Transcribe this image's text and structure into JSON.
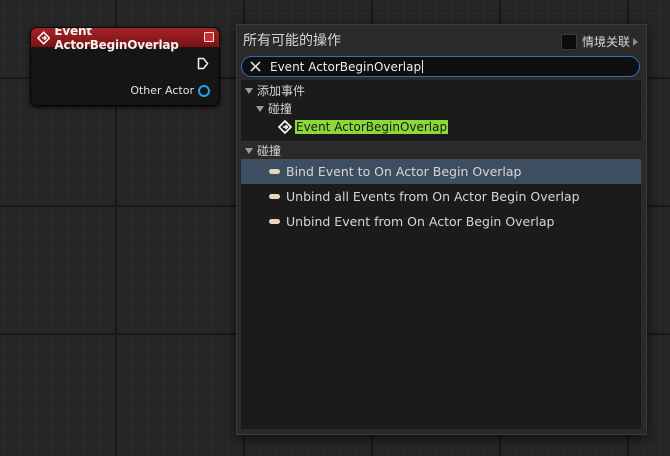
{
  "node": {
    "title": "Event ActorBeginOverlap",
    "pin_label": "Other Actor",
    "header_color": "#a52326",
    "pin_color": "#22a4e6",
    "header_icon": "event-diamond-icon"
  },
  "menu": {
    "title": "所有可能的操作",
    "context_label": "情境关联",
    "search_value": "Event ActorBeginOverlap",
    "tree": [
      {
        "label": "添加事件",
        "type": "category",
        "level": 0
      },
      {
        "label": "碰撞",
        "type": "category",
        "level": 1
      },
      {
        "label": "Event ActorBeginOverlap",
        "type": "event",
        "level": 2,
        "matched": true
      },
      {
        "label": "碰撞",
        "type": "category",
        "level": 0
      }
    ],
    "actions": [
      {
        "label": "Bind Event to On Actor Begin Overlap",
        "selected": true
      },
      {
        "label": "Unbind all Events from On Actor Begin Overlap",
        "selected": false
      },
      {
        "label": "Unbind Event from On Actor Begin Overlap",
        "selected": false
      }
    ],
    "match_color": "#8cd838",
    "selection_color": "#3d4e62"
  }
}
